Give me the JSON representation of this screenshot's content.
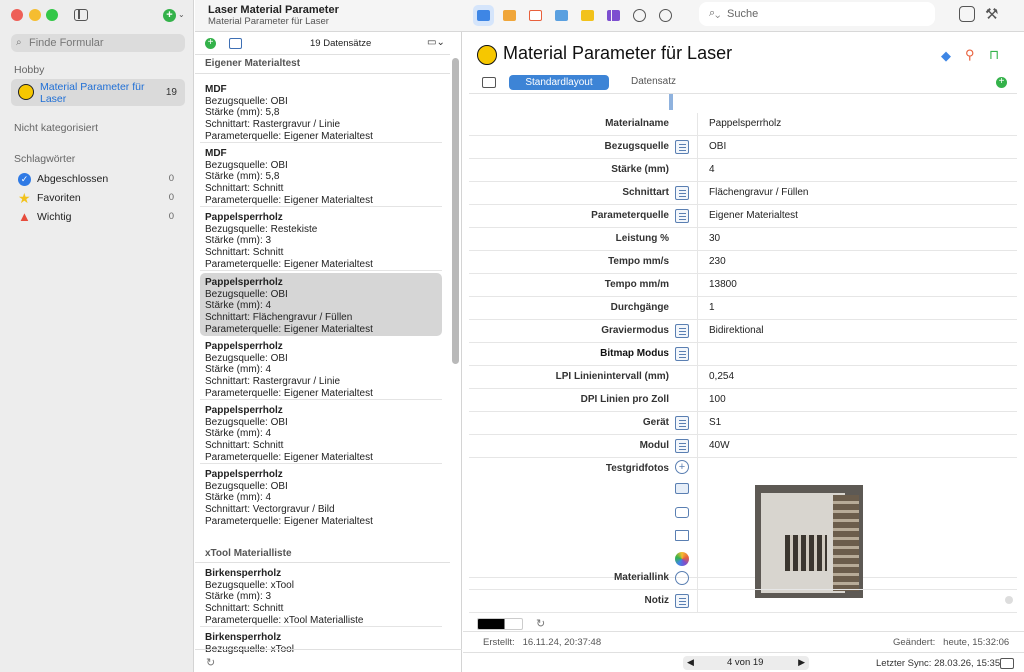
{
  "window": {
    "title": "Laser Material Parameter",
    "subtitle": "Material Parameter für Laser"
  },
  "sidebar": {
    "search_placeholder": "Finde Formular",
    "section_hobby": "Hobby",
    "favorite": {
      "label": "Material Parameter für Laser",
      "count": "19"
    },
    "uncategorized": "Nicht kategorisiert",
    "tags_header": "Schlagwörter",
    "tags": [
      {
        "label": "Abgeschlossen",
        "count": "0",
        "color": "#2f7ae5"
      },
      {
        "label": "Favoriten",
        "count": "0",
        "color": "#f2c21b"
      },
      {
        "label": "Wichtig",
        "count": "0",
        "color": "#e74c3c"
      }
    ]
  },
  "toolbar": {
    "search_placeholder": "Suche"
  },
  "list": {
    "count_label": "19 Datensätze",
    "group1": "Eigener Materialtest",
    "group2": "xTool Materialliste",
    "items": [
      {
        "title": "MDF",
        "l1": "Bezugsquelle: OBI",
        "l2": "Stärke (mm): 5,8",
        "l3": "Schnittart: Rastergravur / Linie",
        "l4": "Parameterquelle: Eigener Materialtest"
      },
      {
        "title": "MDF",
        "l1": "Bezugsquelle: OBI",
        "l2": "Stärke (mm): 5,8",
        "l3": "Schnittart: Schnitt",
        "l4": "Parameterquelle: Eigener Materialtest"
      },
      {
        "title": "Pappelsperrholz",
        "l1": "Bezugsquelle: Restekiste",
        "l2": "Stärke (mm): 3",
        "l3": "Schnittart: Schnitt",
        "l4": "Parameterquelle: Eigener Materialtest"
      },
      {
        "title": "Pappelsperrholz",
        "l1": "Bezugsquelle: OBI",
        "l2": "Stärke (mm): 4",
        "l3": "Schnittart: Flächengravur / Füllen",
        "l4": "Parameterquelle: Eigener Materialtest"
      },
      {
        "title": "Pappelsperrholz",
        "l1": "Bezugsquelle: OBI",
        "l2": "Stärke (mm): 4",
        "l3": "Schnittart: Rastergravur / Linie",
        "l4": "Parameterquelle: Eigener Materialtest"
      },
      {
        "title": "Pappelsperrholz",
        "l1": "Bezugsquelle: OBI",
        "l2": "Stärke (mm): 4",
        "l3": "Schnittart: Schnitt",
        "l4": "Parameterquelle: Eigener Materialtest"
      },
      {
        "title": "Pappelsperrholz",
        "l1": "Bezugsquelle: OBI",
        "l2": "Stärke (mm): 4",
        "l3": "Schnittart: Vectorgravur / Bild",
        "l4": "Parameterquelle: Eigener Materialtest"
      },
      {
        "title": "Birkensperrholz",
        "l1": "Bezugsquelle: xTool",
        "l2": "Stärke (mm): 3",
        "l3": "Schnittart: Schnitt",
        "l4": "Parameterquelle: xTool Materialliste"
      },
      {
        "title": "Birkensperrholz",
        "l1": "Bezugsquelle: xTool",
        "l2": "",
        "l3": "",
        "l4": ""
      }
    ]
  },
  "detail": {
    "title": "Material Parameter für Laser",
    "tab1": "Standardlayout",
    "tab2": "Datensatz",
    "fields": [
      {
        "label": "Materialname",
        "value": "Pappelsperrholz"
      },
      {
        "label": "Bezugsquelle",
        "value": "OBI"
      },
      {
        "label": "Stärke (mm)",
        "value": "4"
      },
      {
        "label": "Schnittart",
        "value": "Flächengravur / Füllen"
      },
      {
        "label": "Parameterquelle",
        "value": "Eigener Materialtest"
      },
      {
        "label": "Leistung %",
        "value": "30"
      },
      {
        "label": "Tempo mm/s",
        "value": "230"
      },
      {
        "label": "Tempo mm/m",
        "value": "13800"
      },
      {
        "label": "Durchgänge",
        "value": "1"
      },
      {
        "label": "Graviermodus",
        "value": "Bidirektional"
      },
      {
        "label": "Bitmap Modus",
        "value": ""
      },
      {
        "label": "LPI Linienintervall (mm)",
        "value": "0,254"
      },
      {
        "label": "DPI Linien pro Zoll",
        "value": "100"
      },
      {
        "label": "Gerät",
        "value": "S1"
      },
      {
        "label": "Modul",
        "value": "40W"
      }
    ],
    "photos_label": "Testgridfotos",
    "link_label": "Materiallink",
    "note_label": "Notiz",
    "created": "Erstellt:   16.11.24, 20:37:48",
    "changed": "Geändert:   heute, 15:32:06",
    "pager": "4 von 19",
    "sync": "Letzter Sync: 28.03.26, 15:35"
  }
}
